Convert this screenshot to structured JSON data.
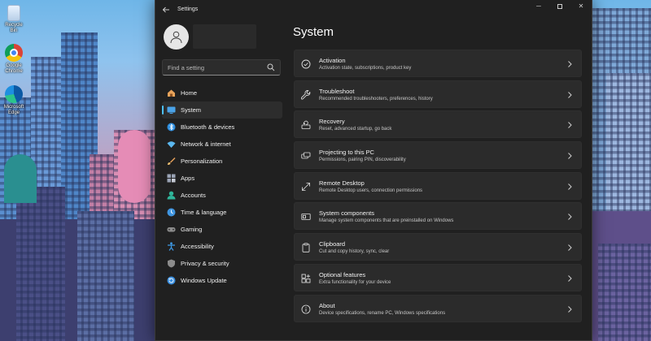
{
  "desktop": {
    "icons": [
      {
        "label": "Recycle Bin",
        "icon": "recycle-bin-icon"
      },
      {
        "label": "Google Chrome",
        "icon": "chrome-icon"
      },
      {
        "label": "Microsoft Edge",
        "icon": "edge-icon"
      }
    ]
  },
  "window": {
    "title": "Settings",
    "caption": {
      "minimize": "─",
      "close": "✕"
    }
  },
  "sidebar": {
    "search_placeholder": "Find a setting",
    "items": [
      {
        "label": "Home",
        "icon": "home-icon",
        "color": "#e8a35a"
      },
      {
        "label": "System",
        "icon": "monitor-icon",
        "color": "#4aa3e8",
        "active": true
      },
      {
        "label": "Bluetooth & devices",
        "icon": "bluetooth-icon",
        "color": "#2f8fe0"
      },
      {
        "label": "Network & internet",
        "icon": "wifi-icon",
        "color": "#5bb8f0"
      },
      {
        "label": "Personalization",
        "icon": "brush-icon",
        "color": "#e8a15a"
      },
      {
        "label": "Apps",
        "icon": "apps-icon",
        "color": "#9aa3b5"
      },
      {
        "label": "Accounts",
        "icon": "person-icon",
        "color": "#2fb59a"
      },
      {
        "label": "Time & language",
        "icon": "globe-clock-icon",
        "color": "#3f95e0"
      },
      {
        "label": "Gaming",
        "icon": "gamepad-icon",
        "color": "#8c8c8c"
      },
      {
        "label": "Accessibility",
        "icon": "accessibility-icon",
        "color": "#3e9be8"
      },
      {
        "label": "Privacy & security",
        "icon": "shield-icon",
        "color": "#8d8d8d"
      },
      {
        "label": "Windows Update",
        "icon": "update-icon",
        "color": "#3a8fe0"
      }
    ]
  },
  "main": {
    "title": "System",
    "cards": [
      {
        "title": "Activation",
        "subtitle": "Activation state, subscriptions, product key",
        "icon": "check-circle-icon"
      },
      {
        "title": "Troubleshoot",
        "subtitle": "Recommended troubleshooters, preferences, history",
        "icon": "wrench-icon"
      },
      {
        "title": "Recovery",
        "subtitle": "Reset, advanced startup, go back",
        "icon": "recovery-icon"
      },
      {
        "title": "Projecting to this PC",
        "subtitle": "Permissions, pairing PIN, discoverability",
        "icon": "projector-icon"
      },
      {
        "title": "Remote Desktop",
        "subtitle": "Remote Desktop users, connection permissions",
        "icon": "remote-desktop-icon"
      },
      {
        "title": "System components",
        "subtitle": "Manage system components that are preinstalled on Windows",
        "icon": "components-icon"
      },
      {
        "title": "Clipboard",
        "subtitle": "Cut and copy history, sync, clear",
        "icon": "clipboard-icon"
      },
      {
        "title": "Optional features",
        "subtitle": "Extra functionality for your device",
        "icon": "optional-features-icon"
      },
      {
        "title": "About",
        "subtitle": "Device specifications, rename PC, Windows specifications",
        "icon": "info-icon"
      }
    ]
  }
}
